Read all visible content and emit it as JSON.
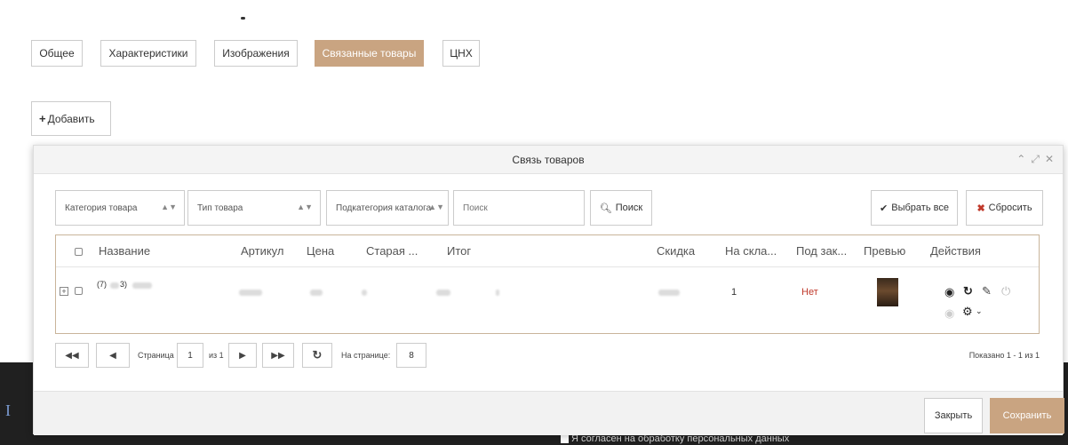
{
  "tabs": [
    {
      "label": "Общее",
      "active": false
    },
    {
      "label": "Характеристики",
      "active": false
    },
    {
      "label": "Изображения",
      "active": false
    },
    {
      "label": "Связанные товары",
      "active": true
    },
    {
      "label": "ЦНХ",
      "active": false
    }
  ],
  "add_button": {
    "icon": "plus-icon",
    "label": "Добавить"
  },
  "modal": {
    "title": "Связь товаров",
    "controls": [
      "chevron-up-icon",
      "expand-icon",
      "close-icon"
    ],
    "filters": {
      "category": "Категория товара",
      "type": "Тип товара",
      "subcategory": "Подкатегория каталога",
      "search_placeholder": "Поиск",
      "search_button": "Поиск",
      "select_all": "Выбрать все",
      "reset": "Сбросить"
    },
    "columns": [
      "Название",
      "Артикул",
      "Цена",
      "Старая ...",
      "Итог",
      "Скидка",
      "На скла...",
      "Под зак...",
      "Превью",
      "Действия"
    ],
    "rows": [
      {
        "name_prefix": "(7)",
        "name_suffix": "3)",
        "stock": "1",
        "on_order": "Нет"
      }
    ],
    "pager": {
      "page_label": "Страница",
      "page_value": "1",
      "of_label": "из 1",
      "per_page_label": "На странице:",
      "per_page_value": "8",
      "shown": "Показано 1 - 1 из 1"
    },
    "footer": {
      "close": "Закрыть",
      "save": "Сохранить"
    }
  },
  "background": {
    "consent": "Я согласен на обработку персональных данных",
    "letter": "I"
  },
  "colors": {
    "accent": "#c9a481",
    "danger": "#c0392b",
    "dark": "#202020"
  }
}
